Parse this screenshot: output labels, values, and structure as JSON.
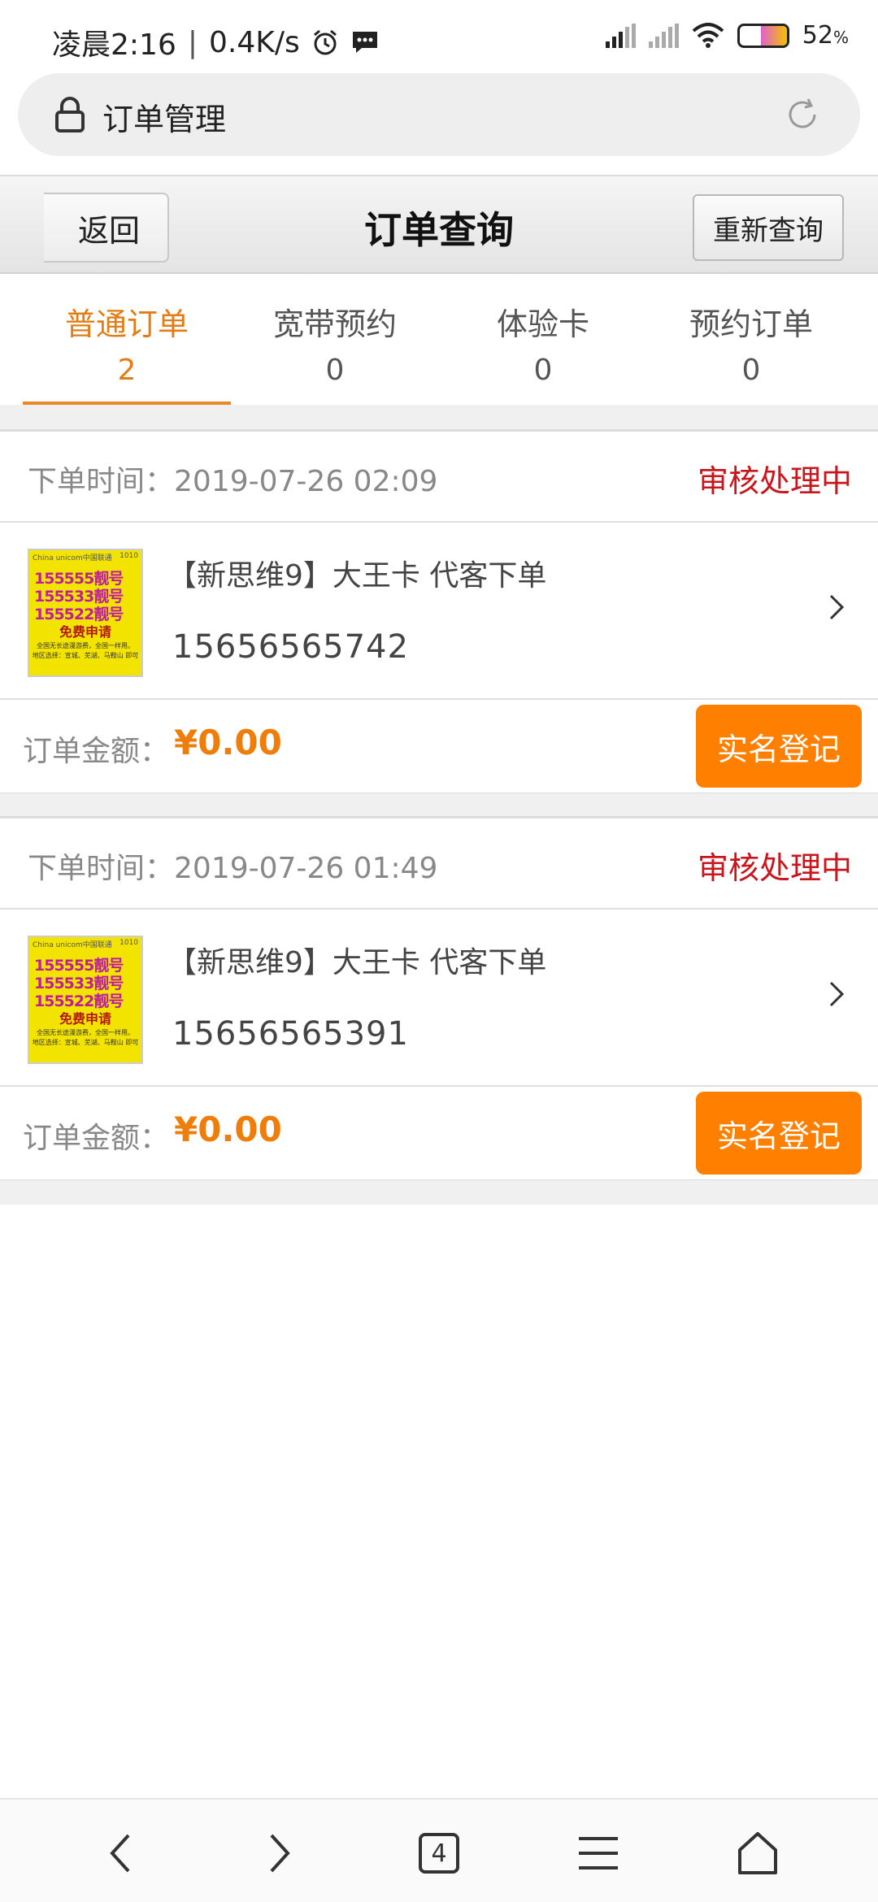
{
  "status_bar": {
    "time": "凌晨2:16",
    "separator": "|",
    "speed": "0.4K/s",
    "battery": "52",
    "battery_unit": "%"
  },
  "address_bar": {
    "title": "订单管理"
  },
  "header": {
    "back_label": "返回",
    "title": "订单查询",
    "requery_label": "重新查询"
  },
  "tabs": [
    {
      "label": "普通订单",
      "count": "2"
    },
    {
      "label": "宽带预约",
      "count": "0"
    },
    {
      "label": "体验卡",
      "count": "0"
    },
    {
      "label": "预约订单",
      "count": "0"
    }
  ],
  "thumbnail": {
    "brand": "China unicom中国联通",
    "corner": "1010",
    "numbers": [
      "155555靓号",
      "155533靓号",
      "155522靓号"
    ],
    "free_text": "免费申请",
    "fine_1": "全国无长途漫游费，全国一样用。",
    "fine_2": "地区选择：宣城、芜湖、马鞍山 即可"
  },
  "orders": [
    {
      "time_label": "下单时间：",
      "time": "2019-07-26   02:09",
      "status": "审核处理中",
      "name": "【新思维9】大王卡 代客下单",
      "phone": "15656565742",
      "amount_label": "订单金额：",
      "amount": "¥0.00",
      "action": "实名登记"
    },
    {
      "time_label": "下单时间：",
      "time": "2019-07-26   01:49",
      "status": "审核处理中",
      "name": "【新思维9】大王卡 代客下单",
      "phone": "15656565391",
      "amount_label": "订单金额：",
      "amount": "¥0.00",
      "action": "实名登记"
    }
  ],
  "bottom_bar": {
    "tab_count": "4"
  },
  "colors": {
    "accent": "#e27d15",
    "status": "#c9161c",
    "button": "#ff7f00"
  }
}
